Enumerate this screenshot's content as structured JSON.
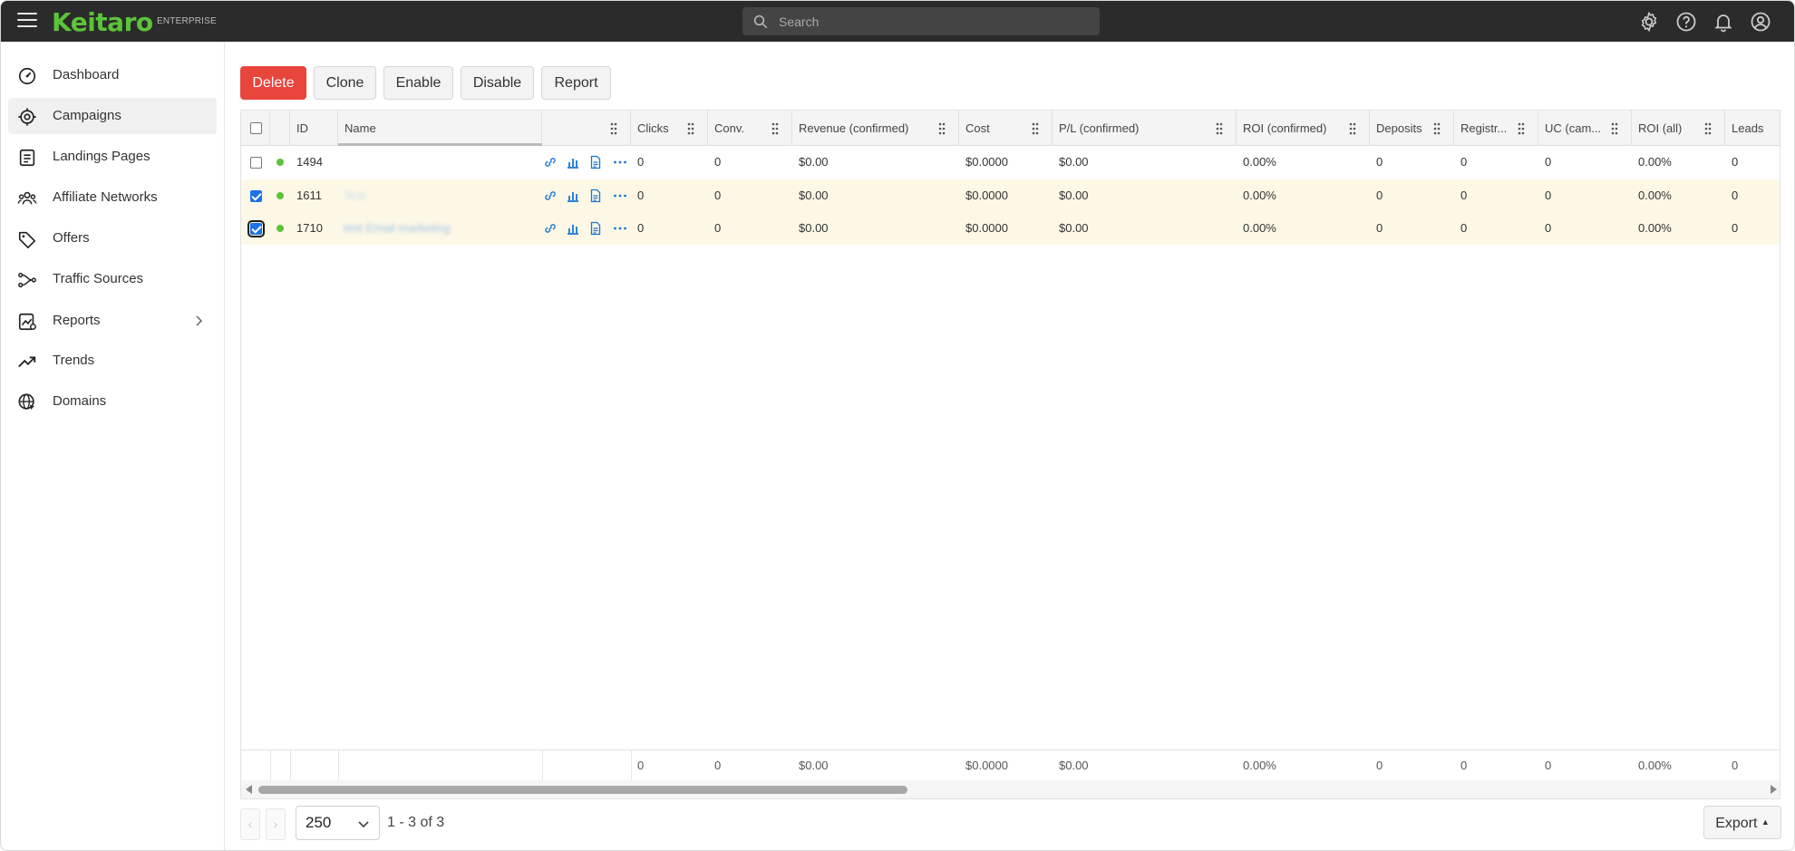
{
  "header": {
    "logo": "Keitaro",
    "edition": "ENTERPRISE",
    "search_placeholder": "Search"
  },
  "sidebar": {
    "items": [
      {
        "label": "Dashboard",
        "icon": "dashboard-icon"
      },
      {
        "label": "Campaigns",
        "icon": "target-icon",
        "active": true
      },
      {
        "label": "Landings Pages",
        "icon": "document-icon"
      },
      {
        "label": "Affiliate Networks",
        "icon": "people-icon"
      },
      {
        "label": "Offers",
        "icon": "tag-icon"
      },
      {
        "label": "Traffic Sources",
        "icon": "branch-icon"
      },
      {
        "label": "Reports",
        "icon": "report-chart-icon",
        "has_submenu": true
      },
      {
        "label": "Trends",
        "icon": "trending-up-icon"
      },
      {
        "label": "Domains",
        "icon": "globe-icon"
      }
    ]
  },
  "toolbar": {
    "delete": "Delete",
    "clone": "Clone",
    "enable": "Enable",
    "disable": "Disable",
    "report": "Report"
  },
  "table": {
    "columns": [
      "ID",
      "Name",
      "",
      "Clicks",
      "Conv.",
      "Revenue (confirmed)",
      "Cost",
      "P/L (confirmed)",
      "ROI (confirmed)",
      "Deposits",
      "Registr...",
      "UC (cam...",
      "ROI (all)",
      "Leads"
    ],
    "rows": [
      {
        "checked": false,
        "status": "active",
        "id": "1494",
        "name": "",
        "clicks": "0",
        "conv": "0",
        "revenue": "$0.00",
        "cost": "$0.0000",
        "pl": "$0.00",
        "roi_confirmed": "0.00%",
        "deposits": "0",
        "registr": "0",
        "uc": "0",
        "roi_all": "0.00%",
        "leads": "0"
      },
      {
        "checked": true,
        "status": "active",
        "id": "1611",
        "name": "Test",
        "clicks": "0",
        "conv": "0",
        "revenue": "$0.00",
        "cost": "$0.0000",
        "pl": "$0.00",
        "roi_confirmed": "0.00%",
        "deposits": "0",
        "registr": "0",
        "uc": "0",
        "roi_all": "0.00%",
        "leads": "0"
      },
      {
        "checked": true,
        "status": "active",
        "id": "1710",
        "name": "test Email marketing",
        "clicks": "0",
        "conv": "0",
        "revenue": "$0.00",
        "cost": "$0.0000",
        "pl": "$0.00",
        "roi_confirmed": "0.00%",
        "deposits": "0",
        "registr": "0",
        "uc": "0",
        "roi_all": "0.00%",
        "leads": "0"
      }
    ],
    "totals": {
      "clicks": "0",
      "conv": "0",
      "revenue": "$0.00",
      "cost": "$0.0000",
      "pl": "$0.00",
      "roi_confirmed": "0.00%",
      "deposits": "0",
      "registr": "0",
      "uc": "0",
      "roi_all": "0.00%",
      "leads": "0"
    }
  },
  "pagination": {
    "prev": "‹",
    "next": "›",
    "page_size": "250",
    "info": "1 - 3 of 3",
    "export": "Export"
  },
  "colors": {
    "brand": "#5cc33a",
    "danger": "#e8453c",
    "link": "#1976d2",
    "selected_row": "#fdf8e6"
  }
}
